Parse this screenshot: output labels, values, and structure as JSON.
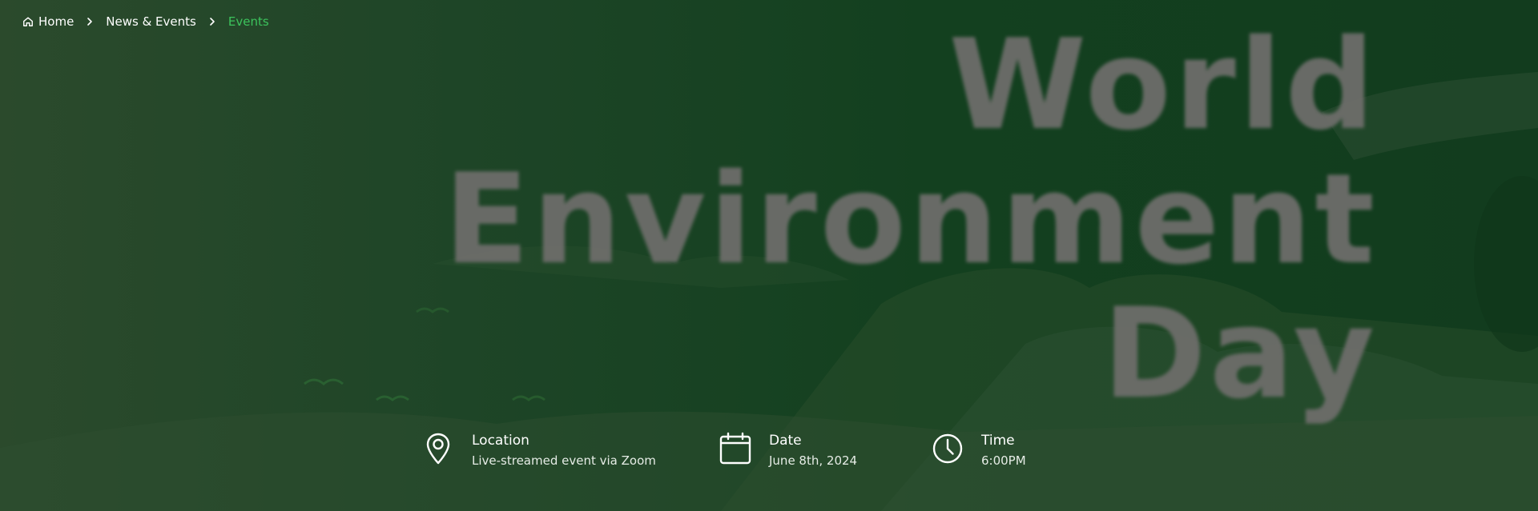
{
  "breadcrumb": {
    "items": [
      {
        "label": "Home",
        "icon": "home-icon"
      },
      {
        "label": "News & Events"
      },
      {
        "label": "Events",
        "current": true
      }
    ],
    "separator_icon": "chevron-right-icon"
  },
  "hero": {
    "title_lines": [
      "World",
      "Environment",
      "Day"
    ]
  },
  "event_info": {
    "location": {
      "label": "Location",
      "value": "Live-streamed event via Zoom",
      "icon": "map-pin-icon"
    },
    "date": {
      "label": "Date",
      "value": "June 8th, 2024",
      "icon": "calendar-icon"
    },
    "time": {
      "label": "Time",
      "value": "6:00PM",
      "icon": "clock-icon"
    }
  },
  "colors": {
    "background": "#173f21",
    "accent": "#3cc35c",
    "title_gray": "#6d6d6a",
    "text": "#ffffff"
  }
}
